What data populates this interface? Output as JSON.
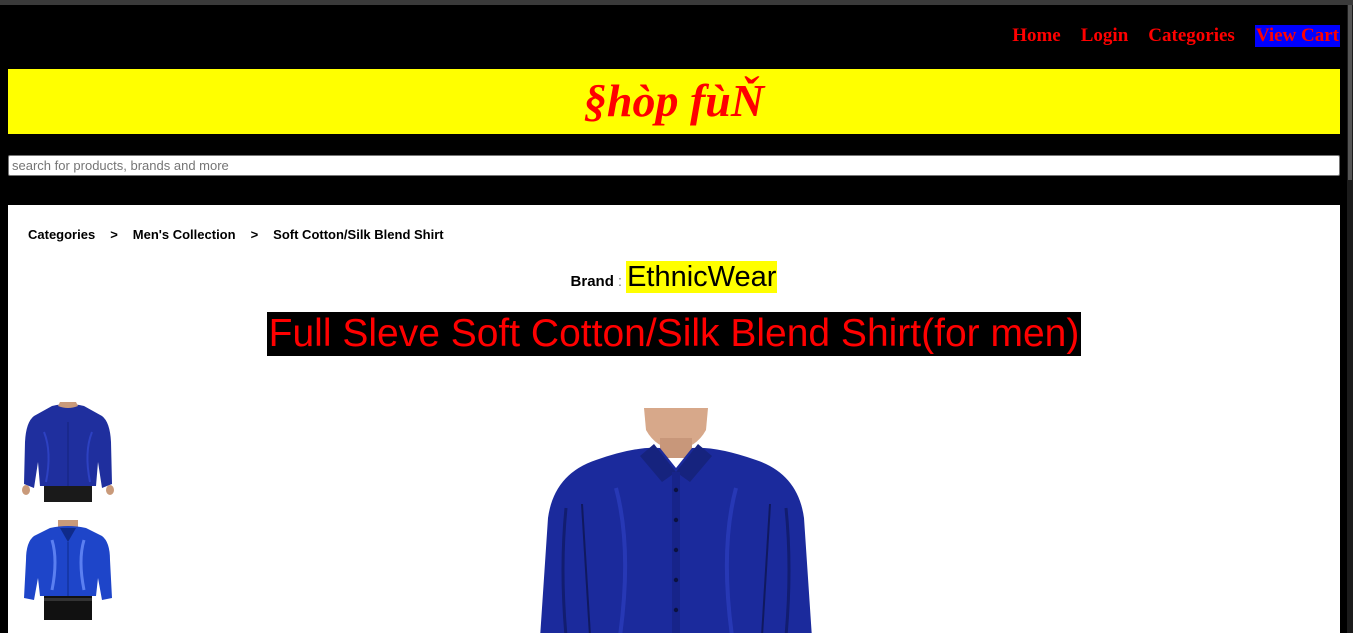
{
  "nav": {
    "items": [
      {
        "label": "Home"
      },
      {
        "label": "Login"
      },
      {
        "label": "Categories"
      },
      {
        "label": "View Cart"
      }
    ]
  },
  "banner": {
    "logo": "§hòp fùŇ"
  },
  "search": {
    "placeholder": "search for products, brands and more",
    "value": ""
  },
  "breadcrumb": {
    "items": [
      "Categories",
      "Men's Collection",
      "Soft Cotton/Silk Blend Shirt"
    ],
    "separator": ">"
  },
  "product": {
    "brand_label": "Brand",
    "brand_colon": ":",
    "brand_name": "EthnicWear",
    "title": "Full Sleve Soft Cotton/Silk Blend Shirt(for men)"
  },
  "colors": {
    "page_bg": "#000000",
    "banner_bg": "#ffff00",
    "accent_red": "#ff0000",
    "cart_bg": "#0000ff",
    "shirt_blue": "#1b2a9c"
  }
}
